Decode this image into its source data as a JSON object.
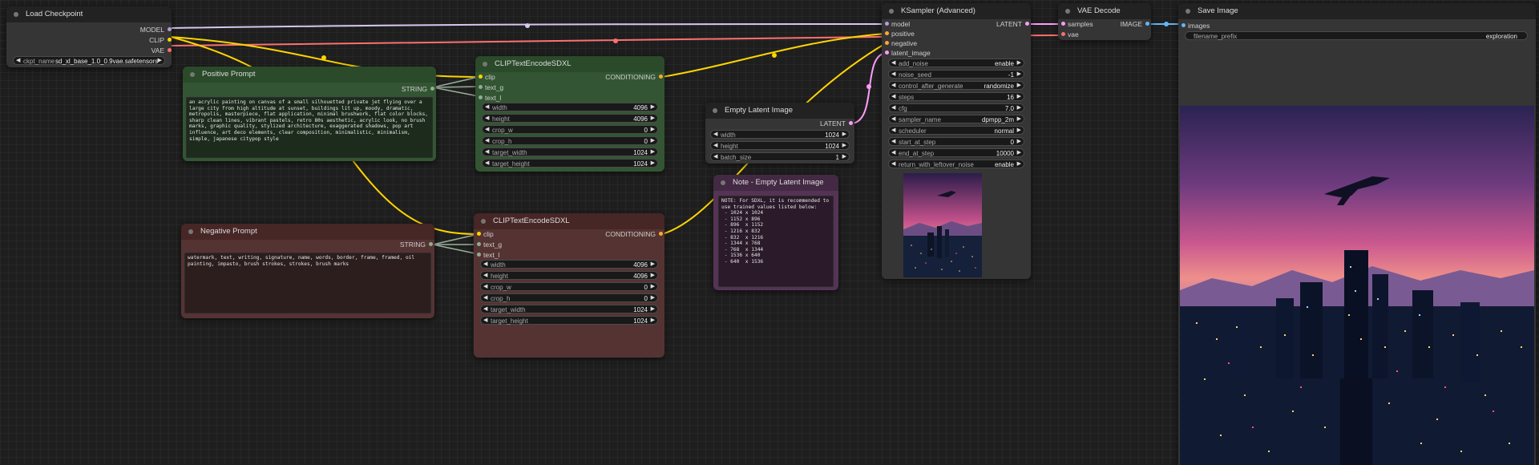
{
  "colors": {
    "model": "#b39ddb",
    "clip": "#ffd500",
    "vae": "#ff6e6e",
    "conditioning": "#ffa931",
    "latent": "#ff9cf9",
    "image": "#64b5f6",
    "string": "#8fae8f"
  },
  "nodes": {
    "load_checkpoint": {
      "title": "Load Checkpoint",
      "outputs": [
        "MODEL",
        "CLIP",
        "VAE"
      ],
      "ckpt_label": "ckpt_name",
      "ckpt_value": "sd_xl_base_1.0_0.9vae.safetensors"
    },
    "positive_prompt": {
      "title": "Positive Prompt",
      "output": "STRING",
      "text": "an acrylic painting on canvas of a small silhouetted private jet flying over a large city from high altitude at sunset, buildings lit up, moody, dramatic, metropolis, masterpiece, flat application, minimal brushwork, flat color blocks, sharp clean lines, vibrant pastels, retro 80s aesthetic, acrylic look, no brush marks, graphic quality, stylized architecture, exaggerated shadows, pop art influence, art deco elements, clear composition, minimalistic, minimalism, simple, japanese citypop style"
    },
    "negative_prompt": {
      "title": "Negative Prompt",
      "output": "STRING",
      "text": "watermark, text, writing, signature, name, words, border, frame, framed, oil painting, impasto, brush strokes, strokes, brush marks"
    },
    "clip_encode_pos": {
      "title": "CLIPTextEncodeSDXL",
      "inputs": [
        "clip",
        "text_g",
        "text_l"
      ],
      "output": "CONDITIONING",
      "widgets": [
        {
          "label": "width",
          "value": "4096"
        },
        {
          "label": "height",
          "value": "4096"
        },
        {
          "label": "crop_w",
          "value": "0"
        },
        {
          "label": "crop_h",
          "value": "0"
        },
        {
          "label": "target_width",
          "value": "1024"
        },
        {
          "label": "target_height",
          "value": "1024"
        }
      ]
    },
    "clip_encode_neg": {
      "title": "CLIPTextEncodeSDXL",
      "inputs": [
        "clip",
        "text_g",
        "text_l"
      ],
      "output": "CONDITIONING",
      "widgets": [
        {
          "label": "width",
          "value": "4096"
        },
        {
          "label": "height",
          "value": "4096"
        },
        {
          "label": "crop_w",
          "value": "0"
        },
        {
          "label": "crop_h",
          "value": "0"
        },
        {
          "label": "target_width",
          "value": "1024"
        },
        {
          "label": "target_height",
          "value": "1024"
        }
      ]
    },
    "empty_latent": {
      "title": "Empty Latent Image",
      "output": "LATENT",
      "widgets": [
        {
          "label": "width",
          "value": "1024"
        },
        {
          "label": "height",
          "value": "1024"
        },
        {
          "label": "batch_size",
          "value": "1"
        }
      ]
    },
    "note": {
      "title": "Note - Empty Latent Image",
      "text": "NOTE: For SDXL, it is recommended to use trained values listed below:\n - 1024 x 1024\n - 1152 x 896\n - 896  x 1152\n - 1216 x 832\n - 832  x 1216\n - 1344 x 768\n - 768  x 1344\n - 1536 x 640\n - 640  x 1536"
    },
    "ksampler": {
      "title": "KSampler (Advanced)",
      "inputs": [
        "model",
        "positive",
        "negative",
        "latent_image"
      ],
      "output": "LATENT",
      "widgets": [
        {
          "label": "add_noise",
          "value": "enable"
        },
        {
          "label": "noise_seed",
          "value": "-1"
        },
        {
          "label": "control_after_generate",
          "value": "randomize"
        },
        {
          "label": "steps",
          "value": "16"
        },
        {
          "label": "cfg",
          "value": "7.0"
        },
        {
          "label": "sampler_name",
          "value": "dpmpp_2m"
        },
        {
          "label": "scheduler",
          "value": "normal"
        },
        {
          "label": "start_at_step",
          "value": "0"
        },
        {
          "label": "end_at_step",
          "value": "10000"
        },
        {
          "label": "return_with_leftover_noise",
          "value": "enable"
        }
      ]
    },
    "vae_decode": {
      "title": "VAE Decode",
      "inputs": [
        "samples",
        "vae"
      ],
      "output": "IMAGE"
    },
    "save_image": {
      "title": "Save Image",
      "input": "images",
      "prefix_label": "filename_prefix",
      "prefix_value": "exploration"
    }
  }
}
